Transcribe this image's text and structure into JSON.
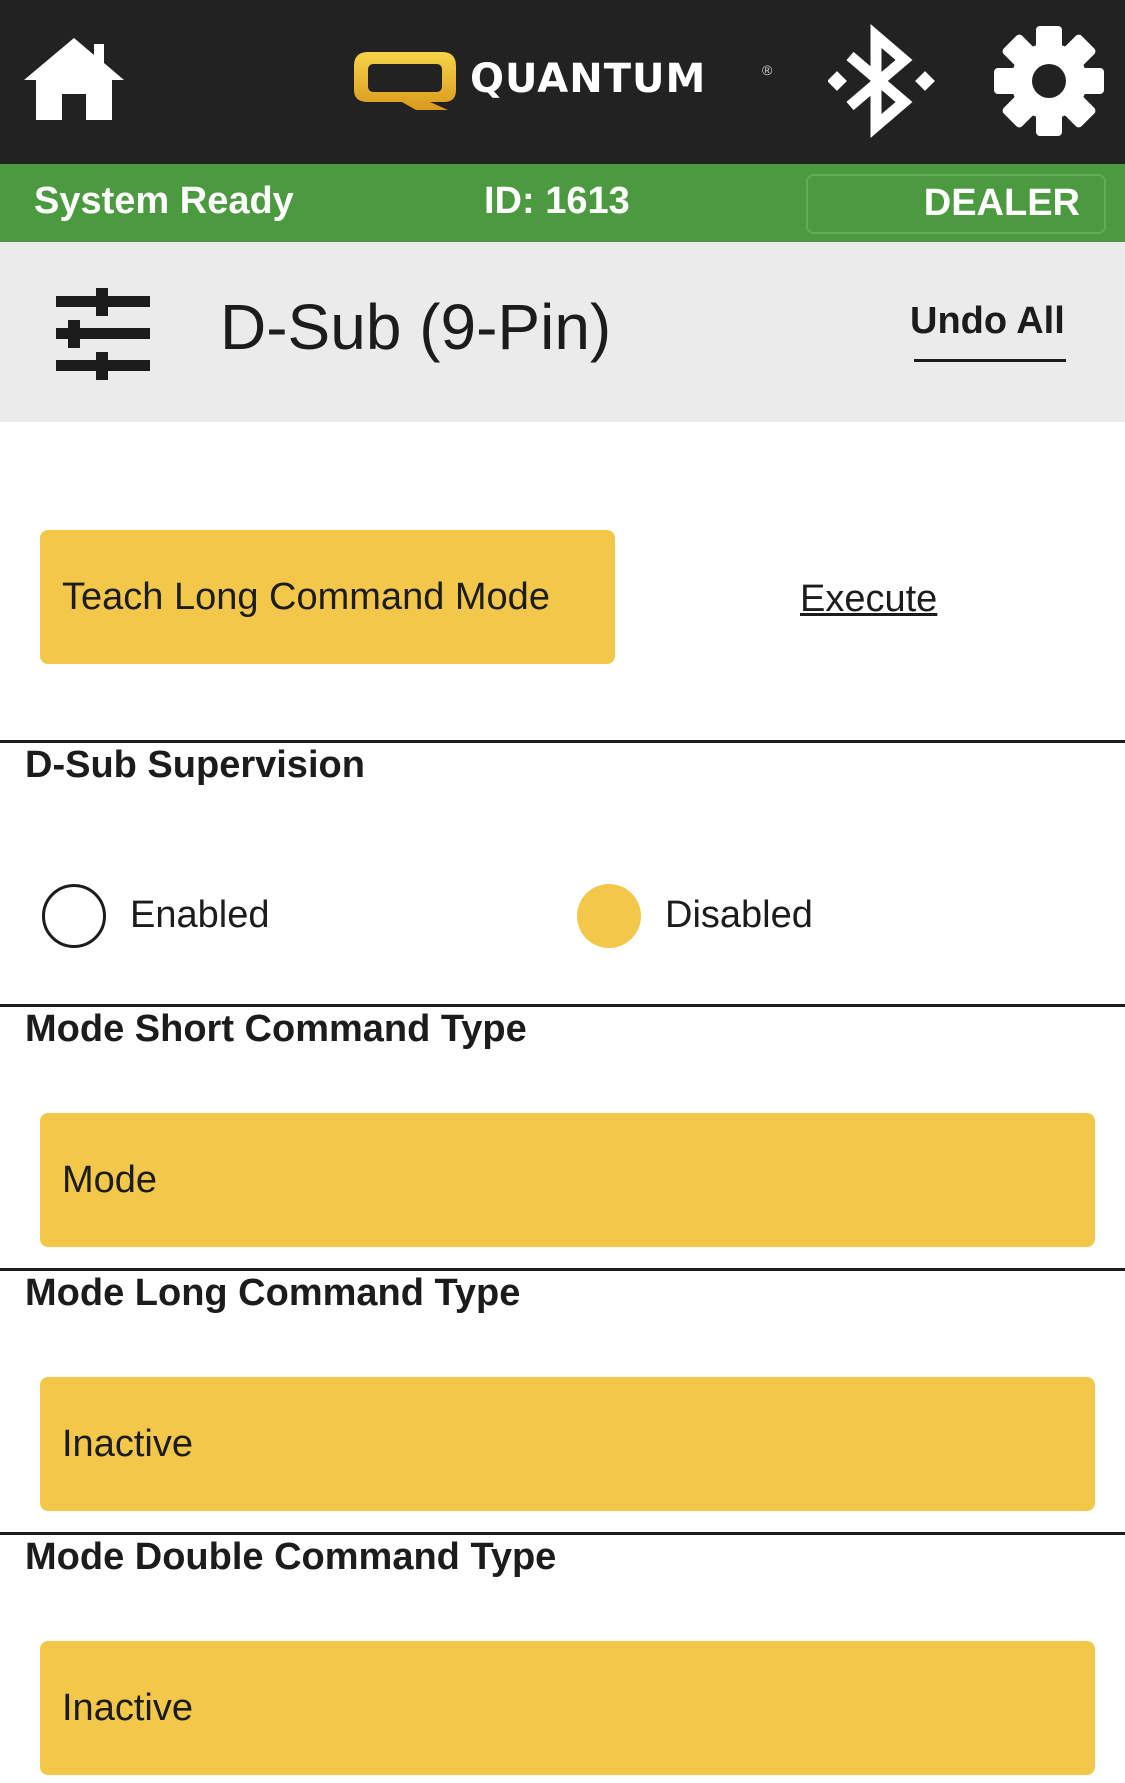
{
  "topbar": {
    "logo_text": "QUANTUM",
    "logo_reg": "®",
    "icons": [
      "home-icon",
      "bluetooth-icon",
      "gear-icon"
    ]
  },
  "status": {
    "text": "System Ready",
    "id_text": "ID: 1613",
    "dealer_label": "DEALER"
  },
  "header": {
    "title": "D-Sub (9-Pin)",
    "undo_label": "Undo All"
  },
  "teach": {
    "button_label": "Teach Long Command Mode",
    "execute_label": "Execute"
  },
  "supervision": {
    "label": "D-Sub Supervision",
    "options": [
      "Enabled",
      "Disabled"
    ],
    "selected": "Disabled"
  },
  "short_command": {
    "label": "Mode Short Command Type",
    "value": "Mode"
  },
  "long_command": {
    "label": "Mode Long Command Type",
    "value": "Inactive"
  },
  "double_command": {
    "label": "Mode Double Command Type",
    "value": "Inactive"
  },
  "colors": {
    "topbar": "#222222",
    "status_green": "#4c9a40",
    "accent_yellow": "#f2c74a",
    "header_gray": "#ebebeb"
  }
}
